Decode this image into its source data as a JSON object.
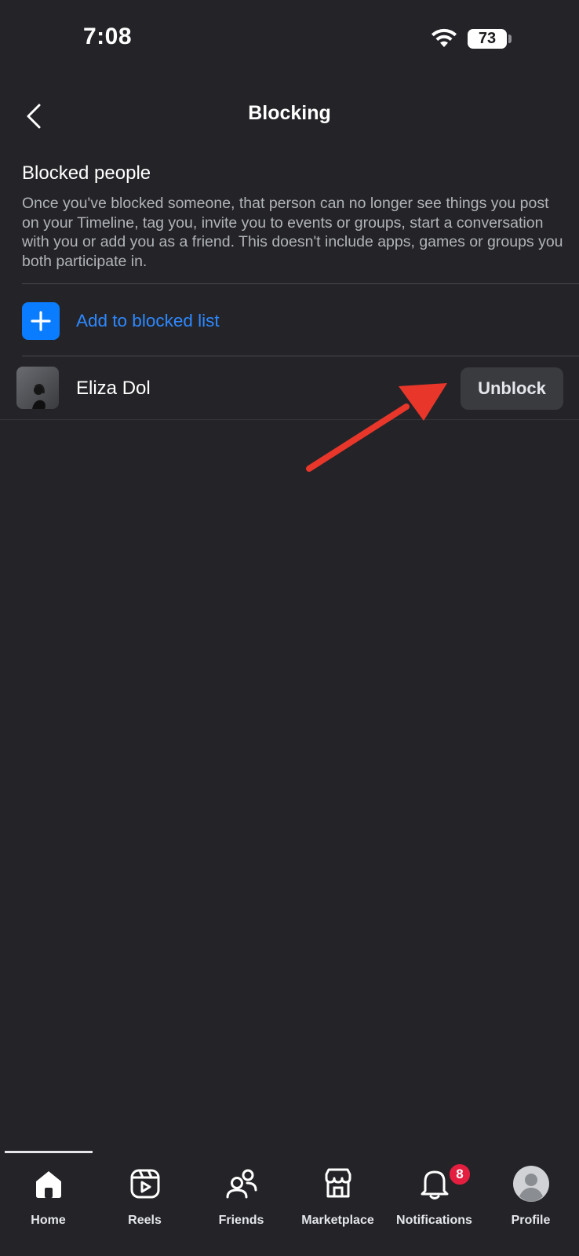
{
  "status_bar": {
    "time": "7:08",
    "battery": "73",
    "icons": [
      "wifi-icon",
      "battery-icon"
    ]
  },
  "header": {
    "title": "Blocking",
    "back_icon": "chevron-left-icon"
  },
  "blocked_section": {
    "title": "Blocked people",
    "description": "Once you've blocked someone, that person can no longer see things you post on your Timeline, tag you, invite you to events or groups, start a conversation with you or add you as a friend. This doesn't include apps, games or groups you both participate in.",
    "add_label": "Add to blocked list",
    "add_icon": "plus-icon"
  },
  "blocked_people": [
    {
      "name": "Eliza Dol",
      "action": "Unblock"
    }
  ],
  "annotation": {
    "icon": "red-arrow",
    "color": "#e8372a"
  },
  "tabs": [
    {
      "label": "Home",
      "icon": "home-icon",
      "active": true
    },
    {
      "label": "Reels",
      "icon": "reels-icon",
      "active": false
    },
    {
      "label": "Friends",
      "icon": "friends-icon",
      "active": false
    },
    {
      "label": "Marketplace",
      "icon": "marketplace-icon",
      "active": false
    },
    {
      "label": "Notifications",
      "icon": "bell-icon",
      "active": false,
      "badge": "8"
    },
    {
      "label": "Profile",
      "icon": "avatar",
      "active": false
    }
  ],
  "colors": {
    "background": "#242428",
    "accent": "#0a7cff",
    "link": "#2d88ff",
    "badge": "#e41e3f"
  }
}
